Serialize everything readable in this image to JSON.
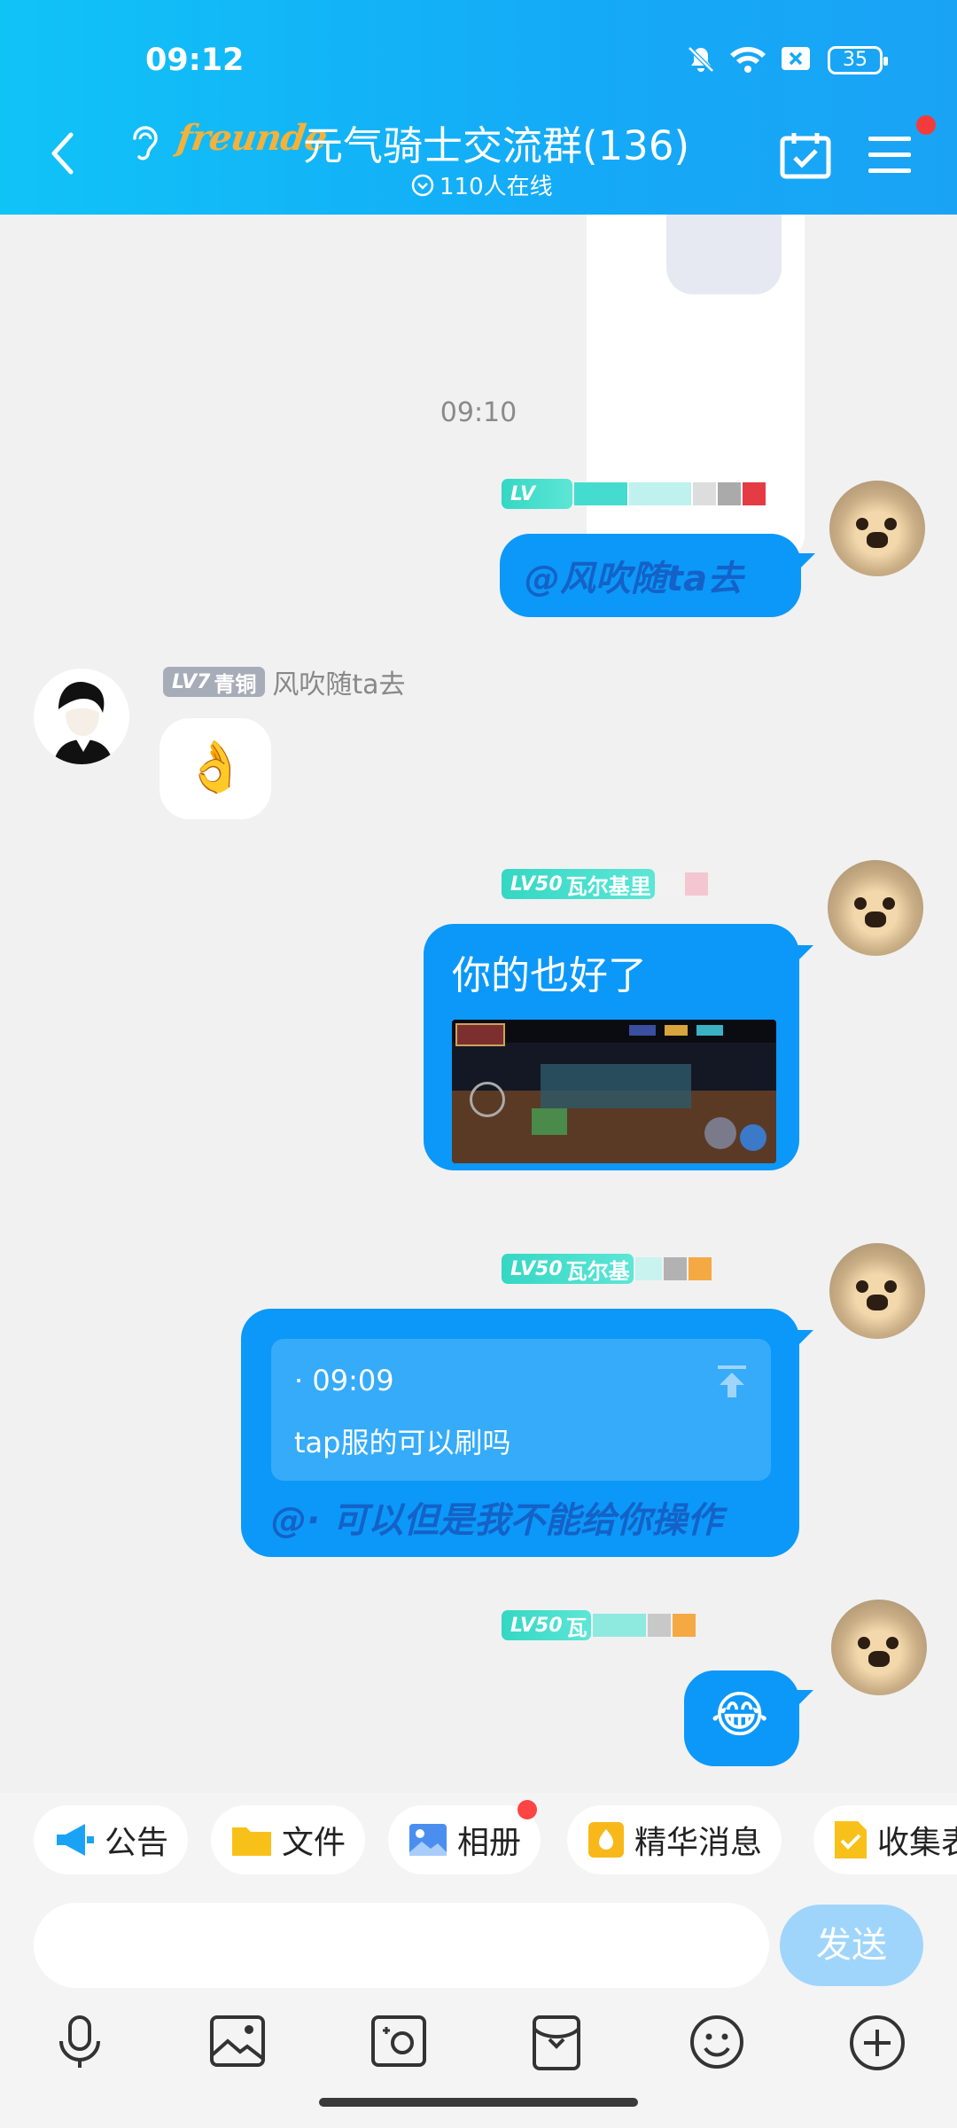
{
  "status": {
    "time": "09:12",
    "battery": "35"
  },
  "header": {
    "logo_text": "freunde",
    "title": "元气骑士交流群(136)",
    "online": "110人在线"
  },
  "chat": {
    "timestamp": "09:10",
    "messages": [
      {
        "side": "right",
        "level": "LV",
        "text": "@风吹随ta去"
      },
      {
        "side": "left",
        "level": "LV7",
        "badge": "青铜",
        "nick": "风吹随ta去",
        "emoji": "👌"
      },
      {
        "side": "right",
        "level": "LV50",
        "nick": "瓦尔基里",
        "text": "你的也好了",
        "has_image": true
      },
      {
        "side": "right",
        "level": "LV50",
        "nick": "瓦尔基",
        "quote_time": "· 09:09",
        "quote_text": "tap服的可以刷吗",
        "text": "@· 可以但是我不能给你操作"
      },
      {
        "side": "right",
        "level": "LV50",
        "nick": "瓦",
        "emoji": "😂"
      }
    ]
  },
  "toolbar": {
    "chips": [
      "公告",
      "文件",
      "相册",
      "精华消息",
      "收集表"
    ]
  },
  "input": {
    "placeholder": "",
    "send_label": "发送"
  },
  "colors": {
    "header_start": "#10c3f7",
    "header_end": "#1aa3f5",
    "bubble": "#0c98f8",
    "level_tag": "#35d7c4"
  },
  "icons": [
    "back-icon",
    "ear-icon",
    "calendar-check-icon",
    "menu-icon",
    "mic-icon",
    "image-icon",
    "camera-icon",
    "red-packet-icon",
    "emoji-icon",
    "plus-icon"
  ]
}
